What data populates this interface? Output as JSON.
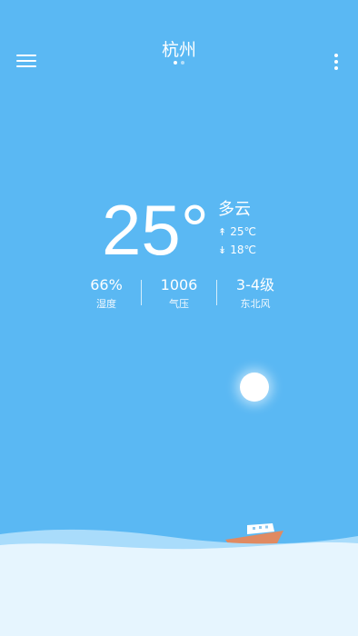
{
  "header": {
    "city": "杭州",
    "menu_icon": "hamburger-menu-icon",
    "more_icon": "more-vertical-icon",
    "page_count": 2,
    "active_page": 1
  },
  "current": {
    "temperature": "25°",
    "condition": "多云",
    "high": "25℃",
    "low": "18℃",
    "high_arrow": "↟",
    "low_arrow": "↡"
  },
  "stats": [
    {
      "value": "66%",
      "label": "湿度"
    },
    {
      "value": "1006",
      "label": "气压"
    },
    {
      "value": "3-4级",
      "label": "东北风"
    }
  ],
  "colors": {
    "sky": "#5ab8f3",
    "wave_back": "#a9dcfb",
    "wave_front": "#e6f5fe",
    "boat_hull": "#e08a62",
    "boat_cabin": "#ffffff"
  },
  "illustration": {
    "sun_icon": "sun-icon",
    "boat_icon": "boat-icon",
    "waves": "sea-waves"
  }
}
